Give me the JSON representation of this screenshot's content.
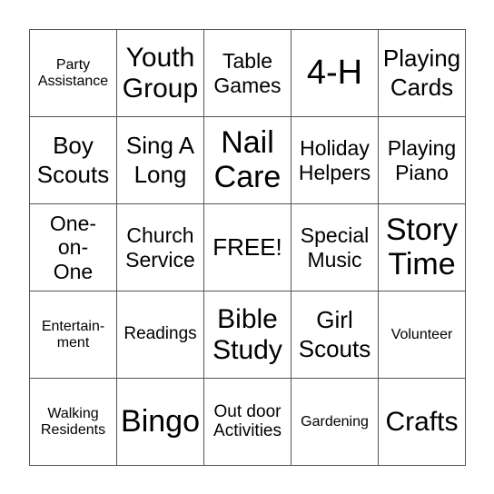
{
  "board": {
    "rows": [
      [
        {
          "text": "Party\nAssistance",
          "size": "s16"
        },
        {
          "text": "Youth\nGroup",
          "size": "s30"
        },
        {
          "text": "Table\nGames",
          "size": "s23"
        },
        {
          "text": "4-H",
          "size": "s38"
        },
        {
          "text": "Playing\nCards",
          "size": "s26"
        }
      ],
      [
        {
          "text": "Boy\nScouts",
          "size": "s26"
        },
        {
          "text": "Sing A\nLong",
          "size": "s26"
        },
        {
          "text": "Nail\nCare",
          "size": "s34"
        },
        {
          "text": "Holiday\nHelpers",
          "size": "s23"
        },
        {
          "text": "Playing\nPiano",
          "size": "s23"
        }
      ],
      [
        {
          "text": "One-\non-\nOne",
          "size": "s23"
        },
        {
          "text": "Church\nService",
          "size": "s23"
        },
        {
          "text": "FREE!",
          "size": "s26"
        },
        {
          "text": "Special\nMusic",
          "size": "s23"
        },
        {
          "text": "Story\nTime",
          "size": "s34"
        }
      ],
      [
        {
          "text": "Entertain-\nment",
          "size": "s16"
        },
        {
          "text": "Readings",
          "size": "s19"
        },
        {
          "text": "Bible\nStudy",
          "size": "s30"
        },
        {
          "text": "Girl\nScouts",
          "size": "s26"
        },
        {
          "text": "Volunteer",
          "size": "s16"
        }
      ],
      [
        {
          "text": "Walking\nResidents",
          "size": "s16"
        },
        {
          "text": "Bingo",
          "size": "s34"
        },
        {
          "text": "Out door\nActivities",
          "size": "s19"
        },
        {
          "text": "Gardening",
          "size": "s16"
        },
        {
          "text": "Crafts",
          "size": "s30"
        }
      ]
    ]
  }
}
